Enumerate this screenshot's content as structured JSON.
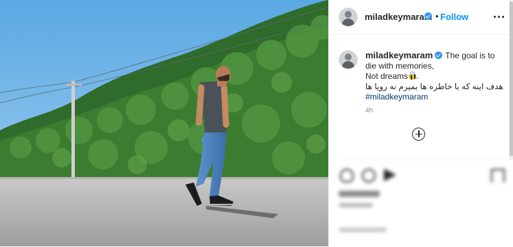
{
  "post": {
    "header": {
      "username": "miladkeymaram",
      "separator": "•",
      "follow_label": "Follow"
    },
    "caption": {
      "username": "miladkeymaram",
      "line1": "The goal is to die with memories,",
      "line2": "Not dreams",
      "line2_end": ".",
      "line3": "هدف اینه که با خاطره ها بمیرم نه رویا ها",
      "hashtag": "#miladkeymaram"
    },
    "time_ago": "4h"
  },
  "icons": [
    "verified-badge-icon",
    "more-options-icon",
    "bee-emoji-icon",
    "load-more-comments-icon",
    "like-icon",
    "comment-icon",
    "share-icon",
    "save-icon"
  ],
  "colors": {
    "link_blue": "#0095f6",
    "verified_blue": "#3897f0",
    "hashtag": "#00376b",
    "muted": "#8e8e8e"
  }
}
